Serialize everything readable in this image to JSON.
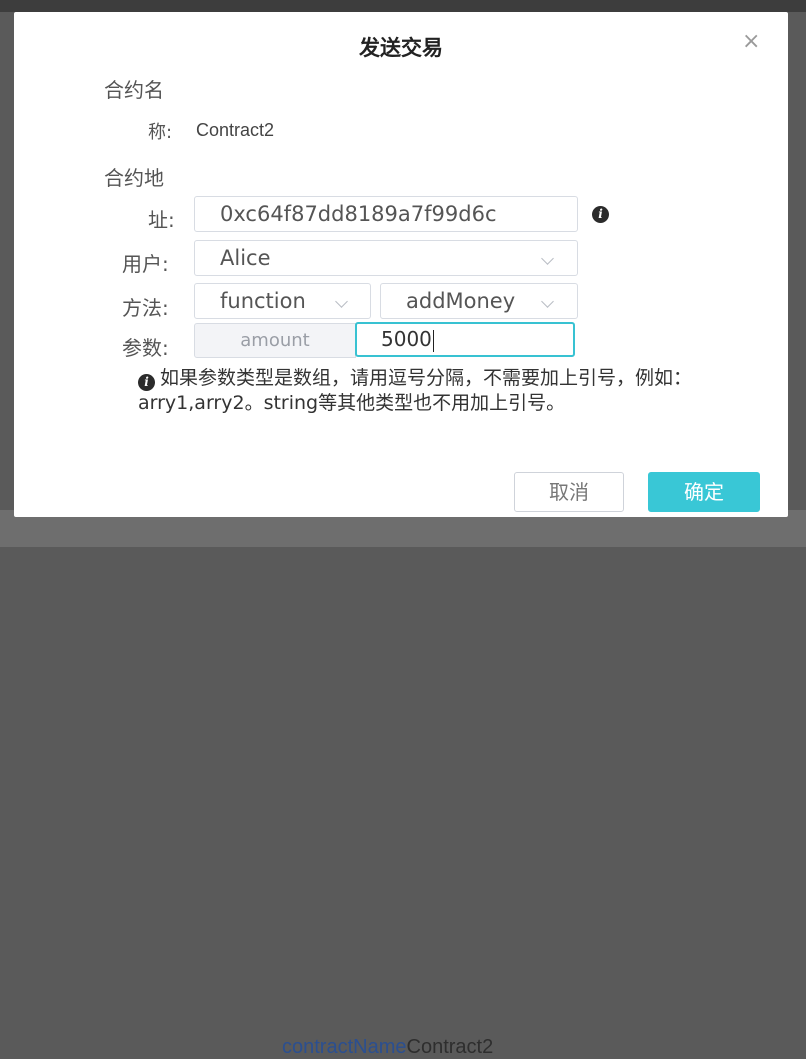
{
  "background": {
    "link_key": "contractName",
    "link_value": "Contract2"
  },
  "dialog": {
    "title": "发送交易",
    "close_glyph": "×",
    "contract_name_label_line1": "合约名",
    "contract_name_label_line2": "称:",
    "contract_name_value": "Contract2",
    "contract_address_label_line1": "合约地",
    "contract_address_label_line2": "址:",
    "contract_address_value": "0xc64f87dd8189a7f99d6c",
    "user_label": "用户:",
    "user_value": "Alice",
    "method_label": "方法:",
    "method_type_value": "function",
    "method_name_value": "addMoney",
    "params_label": "参数:",
    "param_name": "amount",
    "param_value": "5000",
    "hint_text": "如果参数类型是数组，请用逗号分隔，不需要加上引号，例如：arry1,arry2。string等其他类型也不用加上引号。",
    "cancel_label": "取消",
    "confirm_label": "确定",
    "info_glyph": "i"
  },
  "colors": {
    "accent": "#39c7d6",
    "focus_border": "#38c2d2",
    "overlay": "#5a5a5a"
  }
}
